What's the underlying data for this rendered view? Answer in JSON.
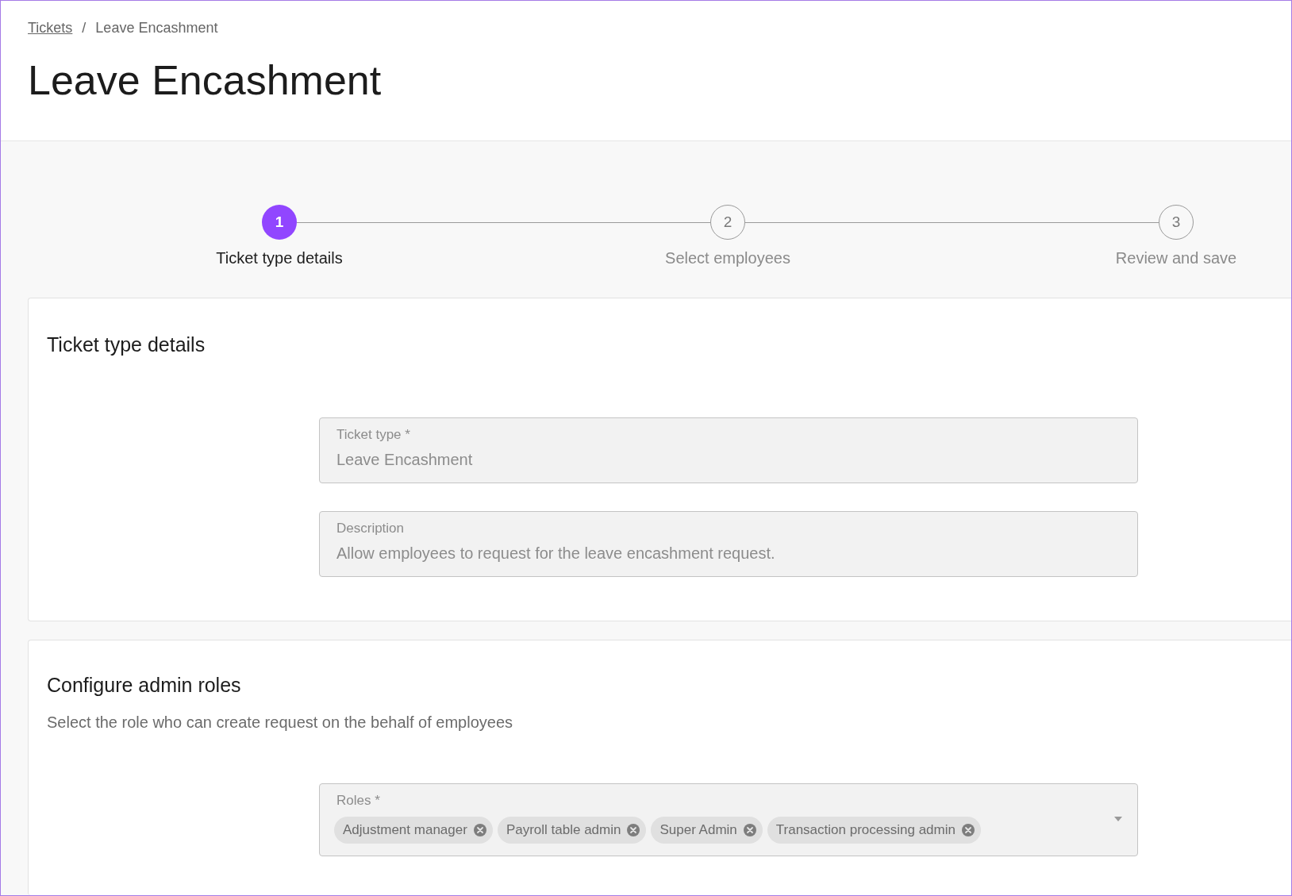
{
  "breadcrumb": [
    {
      "label": "Tickets",
      "kind": "link"
    },
    {
      "label": "Leave Encashment",
      "kind": "current"
    }
  ],
  "breadcrumb_separator": "/",
  "page_title": "Leave Encashment",
  "stepper": [
    {
      "number": "1",
      "label": "Ticket type details",
      "selected": true
    },
    {
      "number": "2",
      "label": "Select employees",
      "selected": false
    },
    {
      "number": "3",
      "label": "Review and save",
      "selected": false
    }
  ],
  "details_card": {
    "title": "Ticket type details",
    "fields": [
      {
        "label": "Ticket type *",
        "value": "Leave Encashment"
      },
      {
        "label": "Description",
        "value": "Allow employees to request for the leave encashment request."
      }
    ]
  },
  "admin_roles_card": {
    "title": "Configure admin roles",
    "subtitle": "Select the role who can create request on the behalf of employees",
    "roles_field": {
      "label": "Roles *",
      "chips": [
        "Adjustment manager",
        "Payroll table admin",
        "Super Admin",
        "Transaction processing admin"
      ]
    }
  }
}
